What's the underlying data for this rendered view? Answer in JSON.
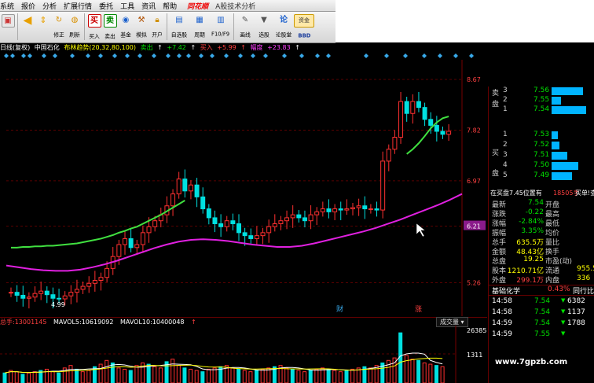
{
  "menu": {
    "items": [
      "系统",
      "报价",
      "分析",
      "扩展行情",
      "委托",
      "工具",
      "资讯",
      "帮助"
    ],
    "brand": "同花顺",
    "subtitle": "A股技术分析"
  },
  "toolbar": {
    "buttons": [
      {
        "label": "",
        "icon": "window-icon"
      },
      {
        "label": "",
        "icon": "back-arrow-icon"
      },
      {
        "label": "",
        "icon": "up-down-arrow-icon"
      },
      {
        "label": "修正",
        "icon": "refresh-icon"
      },
      {
        "label": "刷新",
        "icon": "lock-icon"
      },
      {
        "label": "买入",
        "icon": "buy-icon"
      },
      {
        "label": "卖出",
        "icon": "sell-icon"
      },
      {
        "label": "基金",
        "icon": "fund-icon"
      },
      {
        "label": "模拟",
        "icon": "hammer-icon"
      },
      {
        "label": "开户",
        "icon": "lock-icon"
      },
      {
        "label": "自选股",
        "icon": "monitor-icon"
      },
      {
        "label": "周期",
        "icon": "calendar-icon"
      },
      {
        "label": "F10/F9",
        "icon": "f10-icon"
      },
      {
        "label": "画线",
        "icon": "pen-icon"
      },
      {
        "label": "选股",
        "icon": "filter-icon"
      },
      {
        "label": "论股堂",
        "icon": "chat-icon"
      },
      {
        "label": "BBD",
        "icon": "capital-icon"
      }
    ],
    "capital_label": "资金"
  },
  "info": {
    "period": "日线(复权)",
    "stock": "中国石化",
    "indicator": "布林趋势(20,32,80,100)",
    "sell_label": "卖出",
    "sell_value": "+7.42",
    "buy_label": "买入",
    "buy_value": "+5.99",
    "amp_label": "幅度",
    "amp_value": "+23.83"
  },
  "chart_data": {
    "type": "candlestick",
    "y_ticks": [
      "8.67",
      "7.82",
      "6.97",
      "6.21",
      "5.26"
    ],
    "current_price_label": "6.21",
    "low_label": "4.99",
    "markers": [
      "财",
      "涨"
    ],
    "ylim": [
      4.7,
      9.0
    ],
    "closes": [
      5.1,
      5.05,
      5.0,
      5.02,
      5.08,
      5.12,
      5.06,
      5.0,
      4.99,
      5.04,
      5.1,
      5.15,
      5.2,
      5.25,
      5.3,
      5.35,
      5.5,
      5.7,
      5.9,
      6.0,
      5.85,
      5.9,
      6.1,
      6.2,
      6.3,
      6.4,
      6.55,
      6.75,
      7.0,
      6.8,
      6.9,
      6.7,
      6.5,
      6.35,
      6.25,
      6.2,
      6.3,
      6.25,
      6.1,
      6.05,
      6.0,
      6.05,
      6.1,
      6.2,
      6.25,
      6.3,
      6.35,
      6.4,
      6.35,
      6.3,
      6.4,
      6.45,
      6.5,
      6.45,
      6.5,
      6.48,
      6.5,
      6.52,
      6.55,
      6.5,
      6.5,
      6.48,
      7.3,
      7.5,
      7.7,
      8.3,
      8.1,
      8.3,
      8.2,
      8.0,
      7.9,
      7.8,
      7.75,
      7.8
    ],
    "ma_upper": [
      5.85,
      5.85,
      5.86,
      5.86,
      5.87,
      5.87,
      5.88,
      5.88,
      5.89,
      5.9,
      5.91,
      5.92,
      5.94,
      5.96,
      5.98,
      6.0,
      6.03,
      6.06,
      6.1,
      6.13,
      6.17,
      6.2,
      6.25,
      6.3,
      6.35,
      6.4,
      6.46,
      6.52,
      6.58,
      6.64
    ],
    "ma_lower": [
      5.55,
      5.52,
      5.49,
      5.47,
      5.46,
      5.46,
      5.48,
      5.52,
      5.57,
      5.63,
      5.7,
      5.77,
      5.84,
      5.9,
      5.95,
      5.98,
      5.99,
      5.98,
      5.96,
      5.93,
      5.9,
      5.88,
      5.86,
      5.86,
      5.88,
      5.92,
      5.97,
      6.02,
      6.07,
      6.12,
      6.18,
      6.25,
      6.32,
      6.4,
      6.48,
      6.56,
      6.65,
      6.75
    ],
    "ma_green_tail": [
      7.42,
      7.5,
      7.6,
      7.72,
      7.85,
      7.95,
      8.02,
      8.05
    ]
  },
  "indicator_panel": {
    "vol_label": "总手:",
    "vol_value": "13001145",
    "ma5_label": "MAVOL5:",
    "ma5_value": "10619092",
    "ma10_label": "MAVOL10:",
    "ma10_value": "10400048",
    "unit_label": "成交量",
    "y_top": "26385",
    "y_low": "1311",
    "volumes": [
      8,
      10,
      9,
      7,
      8,
      9,
      10,
      11,
      9,
      8,
      12,
      14,
      11,
      9,
      10,
      13,
      15,
      18,
      16,
      12,
      11,
      10,
      14,
      16,
      15,
      13,
      12,
      17,
      19,
      14,
      12,
      11,
      10,
      9,
      11,
      12,
      13,
      14,
      12,
      11,
      10,
      9,
      10,
      11,
      12,
      13,
      14,
      12,
      11,
      10,
      9,
      10,
      11,
      12,
      11,
      10,
      9,
      10,
      11,
      12,
      13,
      12,
      14,
      16,
      18,
      20,
      40,
      22,
      19,
      18,
      16,
      15,
      14,
      13
    ]
  },
  "side": {
    "sell_tag": "卖盘",
    "buy_tag": "买盘",
    "sells": [
      {
        "idx": "3",
        "price": "7.56",
        "cnt": ""
      },
      {
        "idx": "2",
        "price": "7.55",
        "cnt": ""
      },
      {
        "idx": "1",
        "price": "7.54",
        "cnt": ""
      }
    ],
    "buys": [
      {
        "idx": "1",
        "price": "7.53",
        "cnt": ""
      },
      {
        "idx": "2",
        "price": "7.52",
        "cnt": ""
      },
      {
        "idx": "3",
        "price": "7.51",
        "cnt": ""
      },
      {
        "idx": "4",
        "price": "7.50",
        "cnt": ""
      },
      {
        "idx": "5",
        "price": "7.49",
        "cnt": ""
      }
    ],
    "sell_bars": [
      40,
      12,
      44
    ],
    "buy_bars": [
      8,
      10,
      20,
      34,
      26
    ],
    "inout_label": "在买盘7.45位置有",
    "inout_value": "18505手",
    "inout_tail": "买单!查看",
    "quotes": [
      {
        "k1": "最新",
        "v1": "7.54",
        "k2": "开盘",
        "v2": ""
      },
      {
        "k1": "涨跌",
        "v1": "-0.22",
        "k2": "最高",
        "v2": ""
      },
      {
        "k1": "涨幅",
        "v1": "-2.84%",
        "k2": "最低",
        "v2": ""
      },
      {
        "k1": "振幅",
        "v1": "3.35%",
        "k2": "均价",
        "v2": ""
      },
      {
        "k1": "总手",
        "v1": "635.5万",
        "k2": "量比",
        "v2": ""
      },
      {
        "k1": "金额",
        "v1": "48.43亿",
        "k2": "换手",
        "v2": ""
      },
      {
        "k1": "总盘",
        "v1": "19.25",
        "k2": "市盈(动)",
        "v2": ""
      },
      {
        "k1": "股本",
        "v1": "1210.71亿",
        "k2": "流通",
        "v2": "955.5"
      },
      {
        "k1": "外盘",
        "v1": "299.1万",
        "k2": "内盘",
        "v2": "336"
      }
    ],
    "sector_label": "基础化学",
    "sector_pct": "0.43%",
    "sector_tail": "同行比较",
    "ticks": [
      {
        "time": "14:58",
        "price": "7.54",
        "vol": "6382"
      },
      {
        "time": "14:58",
        "price": "7.54",
        "vol": "1137"
      },
      {
        "time": "14:59",
        "price": "7.54",
        "vol": "1788"
      },
      {
        "time": "14:59",
        "price": "7.55",
        "vol": ""
      }
    ]
  },
  "watermark": "www.7gpzb.com"
}
